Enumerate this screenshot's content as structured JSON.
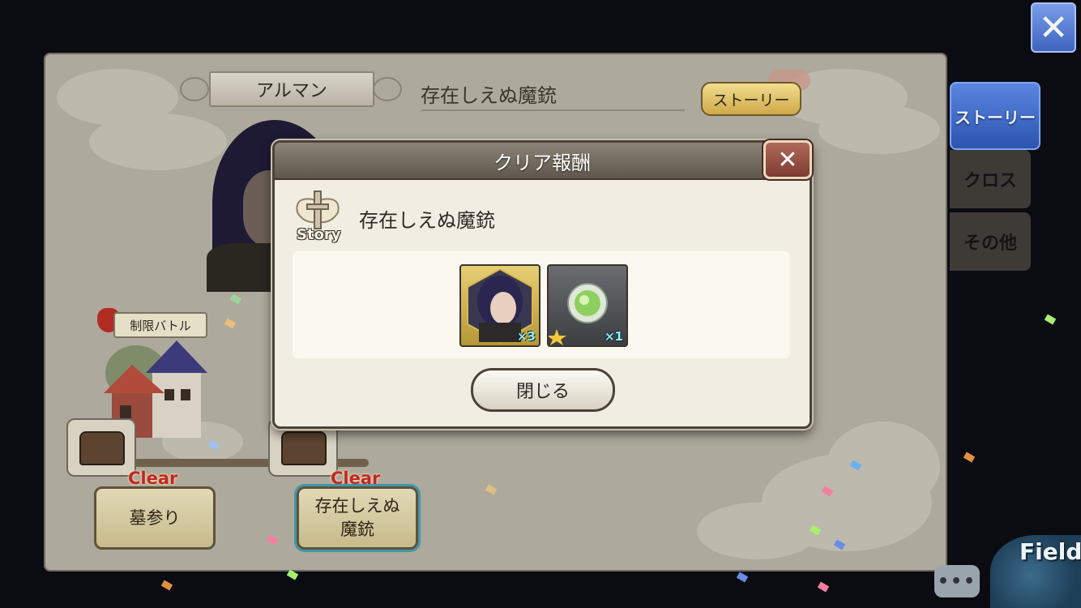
{
  "top_close": {
    "glyph": "✕"
  },
  "character": {
    "name": "アルマン"
  },
  "episode": {
    "title": "存在しえぬ魔銃",
    "story_button": "ストーリー"
  },
  "side_tabs": [
    {
      "label": "ストーリー"
    },
    {
      "label": "クロス"
    },
    {
      "label": "その他"
    }
  ],
  "map": {
    "limit_badge": "制限バトル",
    "stages": [
      {
        "label": "墓参り",
        "status": "Clear"
      },
      {
        "label": "存在しえぬ\n魔銃",
        "status": "Clear"
      }
    ]
  },
  "modal": {
    "title": "クリア報酬",
    "close_glyph": "✕",
    "emblem_text": "Story",
    "reward_title": "存在しえぬ魔銃",
    "rewards": [
      {
        "icon": "character-portrait-icon",
        "quantity": "×3"
      },
      {
        "icon": "green-orb-icon",
        "quantity": "×1"
      }
    ],
    "close_button": "閉じる"
  },
  "footer": {
    "chat": "•••",
    "field": "Field"
  },
  "colors": {
    "accent_blue": "#3d64bf",
    "clear_red": "#c0272d",
    "panel": "#ada99c",
    "modal_bg": "#f1ede2"
  }
}
